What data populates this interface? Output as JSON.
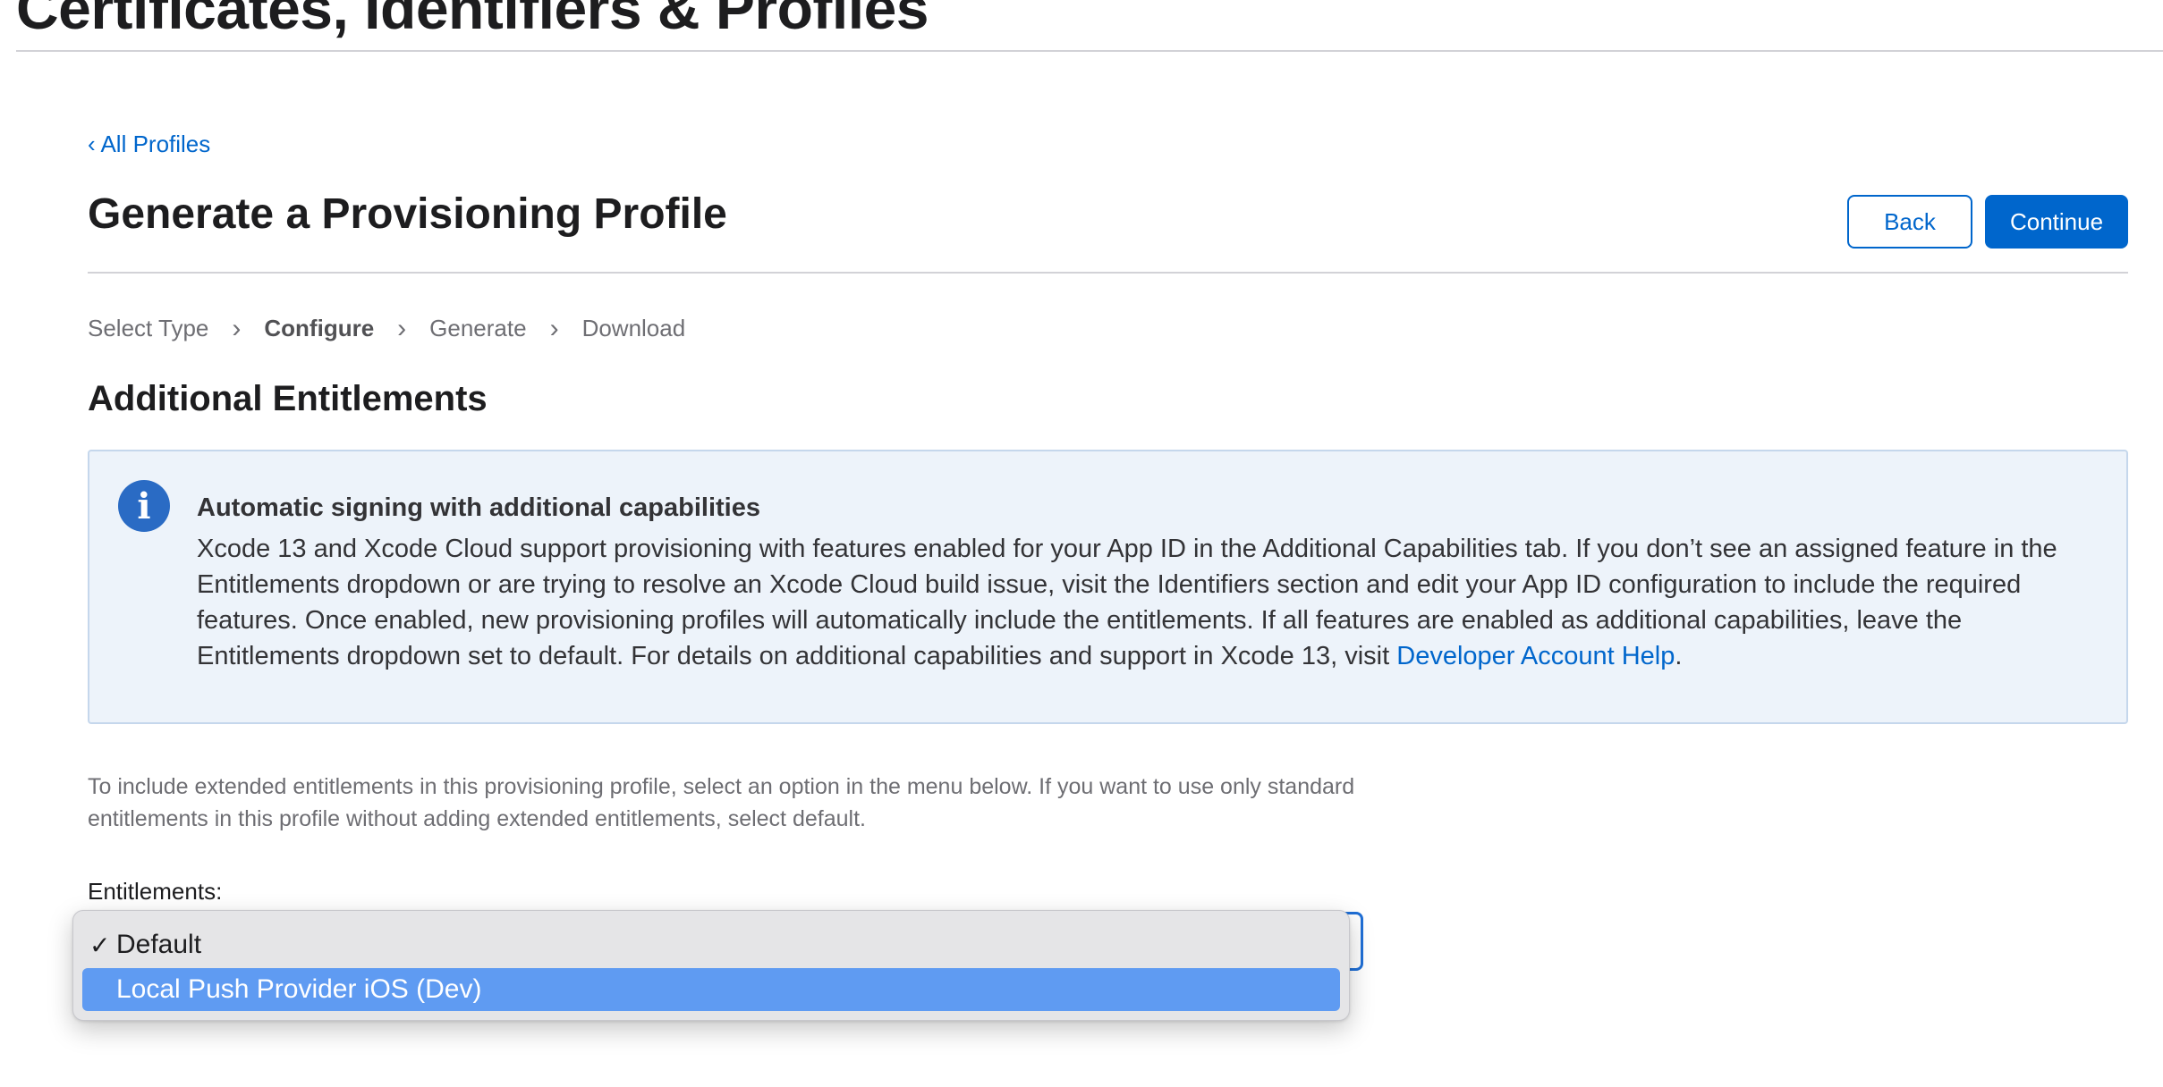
{
  "header": {
    "page_title": "Certificates, Identifiers & Profiles"
  },
  "breadcrumb": {
    "back_label": "‹ All Profiles"
  },
  "main": {
    "title": "Generate a Provisioning Profile",
    "buttons": {
      "back_label": "Back",
      "continue_label": "Continue"
    },
    "steps": [
      {
        "label": "Select Type",
        "active": false
      },
      {
        "label": "Configure",
        "active": true
      },
      {
        "label": "Generate",
        "active": false
      },
      {
        "label": "Download",
        "active": false
      }
    ],
    "section_title": "Additional Entitlements",
    "info": {
      "heading": "Automatic signing with additional capabilities",
      "body": "Xcode 13 and Xcode Cloud support provisioning with features enabled for your App ID in the Additional Capabilities tab. If you don’t see an assigned feature in the Entitlements dropdown or are trying to resolve an Xcode Cloud build issue, visit the Identifiers section and edit your App ID configuration to include the required features. Once enabled, new provisioning profiles will automatically include the entitlements. If all features are enabled as additional capabilities, leave the Entitlements dropdown set to default. For details on additional capabilities and support in Xcode 13, visit ",
      "link_label": "Developer Account Help",
      "body_end": "."
    },
    "helper_text": "To include extended entitlements in this provisioning profile, select an option in the menu below. If you want to use only standard entitlements in this profile without adding extended entitlements, select default.",
    "entitlements": {
      "label": "Entitlements:",
      "options": [
        {
          "label": "Default",
          "checked": true,
          "highlighted": false
        },
        {
          "label": "Local Push Provider iOS (Dev)",
          "checked": false,
          "highlighted": true
        }
      ]
    }
  },
  "colors": {
    "accent": "#0066cc",
    "info_bg": "#edf3fa",
    "menu_highlight": "#5f9bf2"
  },
  "icons": [
    "info-icon",
    "checkmark-icon",
    "chevron-right-icon"
  ]
}
